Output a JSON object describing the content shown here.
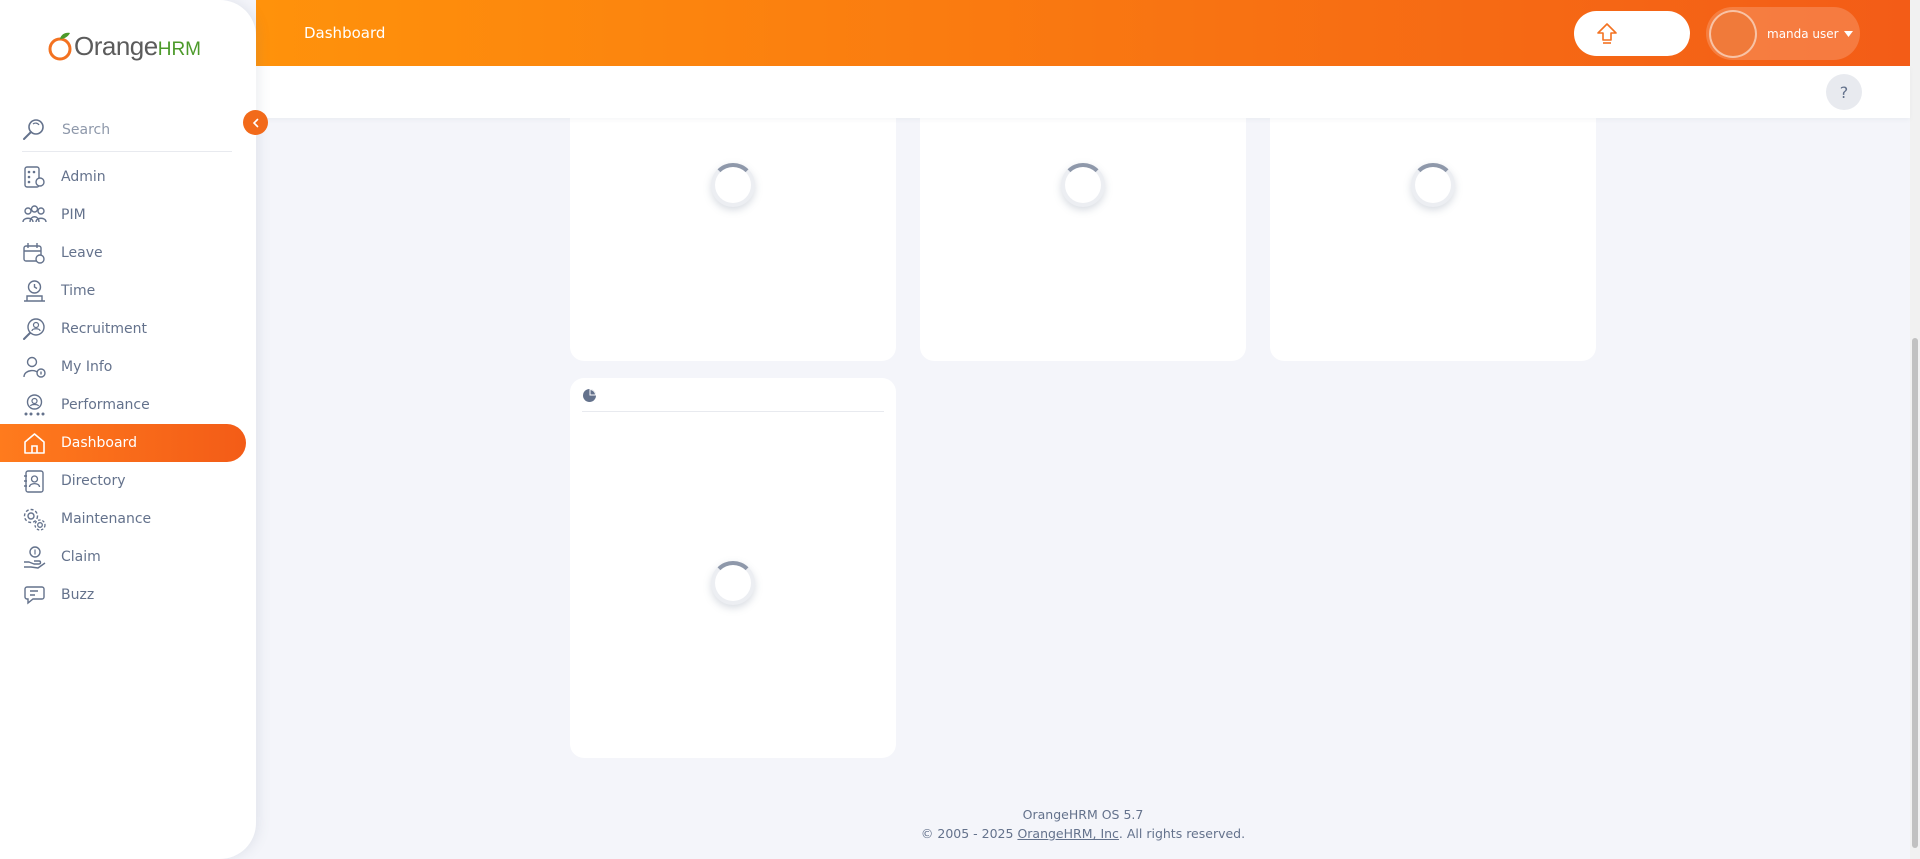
{
  "brand": {
    "logo_main": "Orange",
    "logo_suffix": "HRM"
  },
  "search": {
    "placeholder": "Search"
  },
  "sidebar": {
    "items": [
      {
        "label": "Admin",
        "icon": "admin-icon",
        "active": false
      },
      {
        "label": "PIM",
        "icon": "pim-icon",
        "active": false
      },
      {
        "label": "Leave",
        "icon": "leave-icon",
        "active": false
      },
      {
        "label": "Time",
        "icon": "time-icon",
        "active": false
      },
      {
        "label": "Recruitment",
        "icon": "recruitment-icon",
        "active": false
      },
      {
        "label": "My Info",
        "icon": "my-info-icon",
        "active": false
      },
      {
        "label": "Performance",
        "icon": "performance-icon",
        "active": false
      },
      {
        "label": "Dashboard",
        "icon": "dashboard-icon",
        "active": true
      },
      {
        "label": "Directory",
        "icon": "directory-icon",
        "active": false
      },
      {
        "label": "Maintenance",
        "icon": "maintenance-icon",
        "active": false
      },
      {
        "label": "Claim",
        "icon": "claim-icon",
        "active": false
      },
      {
        "label": "Buzz",
        "icon": "buzz-icon",
        "active": false
      }
    ]
  },
  "topbar": {
    "title": "Dashboard",
    "user_name": "manda user"
  },
  "subbar": {
    "help_label": "?"
  },
  "footer": {
    "version": "OrangeHRM OS 5.7",
    "copyright_prefix": "© 2005 - 2025 ",
    "company_link": "OrangeHRM, Inc",
    "copyright_suffix": ". All rights reserved."
  },
  "colors": {
    "accent": "#ff7b1d",
    "accent_dark": "#f35c17",
    "background": "#f4f5fa",
    "text": "#64728c"
  }
}
